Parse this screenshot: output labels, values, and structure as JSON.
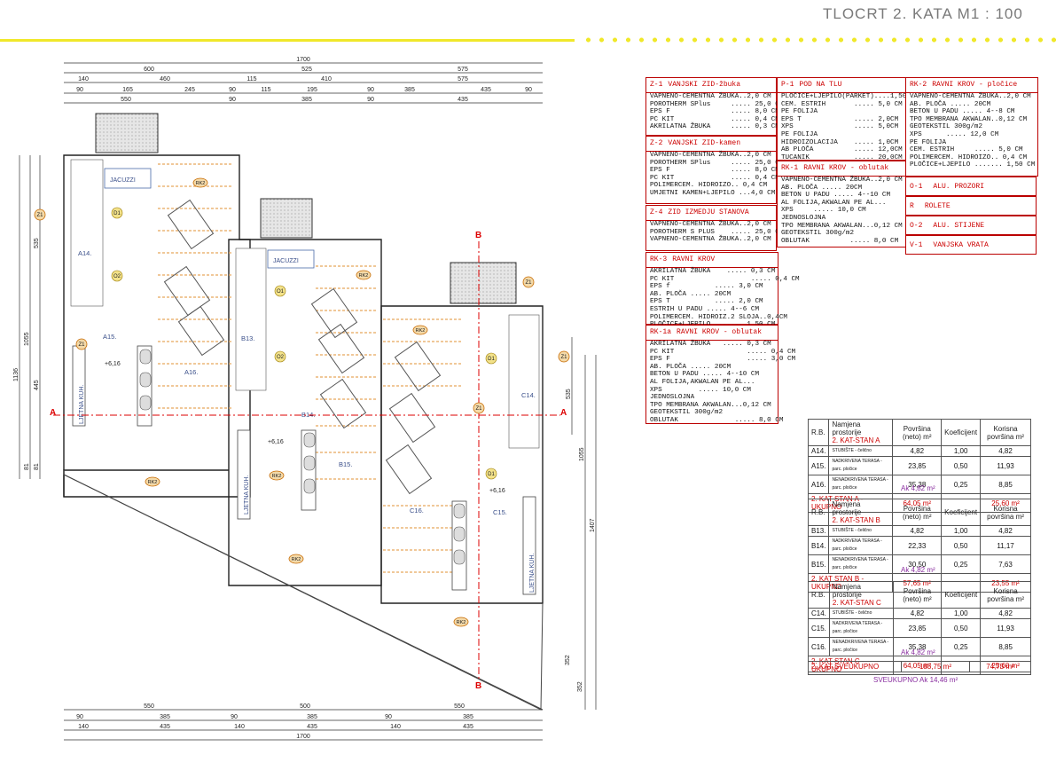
{
  "header": {
    "title": "TLOCRT  2. KATA   M1 : 100",
    "accent": "#f0e82a"
  },
  "plan": {
    "dim_top": {
      "row1": [
        "1700"
      ],
      "row2": [
        "600",
        "525",
        "575"
      ],
      "row3": [
        "140",
        "460",
        "115",
        "410",
        "575"
      ],
      "row4": [
        "90",
        "165",
        "245",
        "90",
        "115",
        "195",
        "90",
        "385",
        "435",
        "90"
      ],
      "row5": [
        "550",
        "90",
        "385",
        "90",
        "435"
      ]
    },
    "dim_bottom": {
      "row1": [
        "550",
        "500",
        "550"
      ],
      "row2": [
        "90",
        "385",
        "90",
        "385",
        "90",
        "385"
      ],
      "row3": [
        "140",
        "435",
        "140",
        "435",
        "140",
        "435"
      ],
      "row4": [
        "1700"
      ]
    },
    "dim_left": [
      "1136",
      "1055",
      "535",
      "445",
      "81",
      "81"
    ],
    "dim_right": [
      "535",
      "1055",
      "1407",
      "352",
      "352"
    ],
    "rooms": [
      "A14.",
      "A15.",
      "A16.",
      "B13.",
      "B14.",
      "B15.",
      "C14.",
      "C15.",
      "C16."
    ],
    "jacuzzi": "JACUZZI",
    "kitchen": "LJETNA KUH.",
    "levels": [
      "+6,16",
      "+6,16",
      "+6,16"
    ],
    "section_marks": [
      "A",
      "A",
      "B",
      "B"
    ],
    "axes": [
      "Z1",
      "Z1",
      "Z1",
      "Z1",
      "Z1"
    ],
    "tags": {
      "door": "D1",
      "window": "O1",
      "window2": "O2"
    },
    "roof_tag": "RK2"
  },
  "specs": {
    "z1": {
      "code": "Z-1",
      "name": "VANJSKI ZID-žbuka",
      "lines": [
        "VAPNENO-CEMENTNA ŽBUKA..2,0 CM",
        "POROTHERM SPlus     ..... 25,0 CM",
        "EPS F               ..... 8,0 CM",
        "PC KIT              ..... 0,4 CM",
        "AKRILATNA ŽBUKA     ..... 0,3 CM"
      ]
    },
    "z2": {
      "code": "Z-2",
      "name": "VANJSKI ZID-kamen",
      "lines": [
        "VAPNENO-CEMENTNA ŽBUKA..2,0 CM",
        "POROTHERM SPlus     ..... 25,0 CM",
        "EPS F               ..... 8,0 CM",
        "PC KIT              ..... 0,4 CM",
        "POLIMERCEM. HIDROIZO.. 0,4 CM",
        "UMJETNI KAMEN+LJEPILO ...4,0 CM"
      ]
    },
    "z4": {
      "code": "Z-4",
      "name": "ZID IZMEDJU STANOVA",
      "lines": [
        "VAPNENO-CEMENTNA ŽBUKA..2,0 CM",
        "POROTHERM S PLUS    ..... 25,0 CM",
        "VAPNENO-CEMENTNA ŽBUKA..2,0 CM"
      ]
    },
    "rk3": {
      "code": "RK-3",
      "name": "RAVNI KROV",
      "lines": [
        "AKRILATNA ŽBUKA    ..... 0,3 CM",
        "PC KIT                   ..... 0,4 CM",
        "EPS f           ..... 3,0 CM",
        "AB. PLOČA ..... 20CM",
        "EPS T           ..... 2,0 CM",
        "ESTRIH U PADU ..... 4--6 CM",
        "POLIMERCEM. HIDROIZ.2 SLOJA..0,4CM",
        "PLOČICE+LJEPILO ....... 1,50 CM"
      ]
    },
    "rk1a": {
      "code": "RK-1a",
      "name": "RAVNI KROV - oblutak",
      "lines": [
        "AKRILATNA ŽBUKA   ..... 0,3 CM",
        "PC KIT                  ..... 0,4 CM",
        "EPS F                   ..... 3,0 CM",
        "AB. PLOČA ..... 20CM",
        "BETON U PADU ..... 4--10 CM",
        "AL FOLIJA,AKWALAN PE AL...",
        "XPS         ..... 10,0 CM",
        "JEDNOSLOJNA",
        "TPO MEMBRANA AKWALAN...0,12 CM",
        "GEOTEKSTIL 300g/m2",
        "OBLUTAK              ..... 8,0 CM"
      ]
    },
    "p1": {
      "code": "P-1",
      "name": "POD NA TLU",
      "lines": [
        "PLOČICE+LJEPILO(PARKET)....1,50CM",
        "CEM. ESTRIH       ..... 5,0 CM",
        "PE FOLIJA",
        "EPS T             ..... 2,0CM",
        "XPS               ..... 5,0CM",
        "PE FOLIJA",
        "HIDROIZOLACIJA    ..... 1,0CM",
        "AB PLOČA          ..... 12,0CM",
        "TUCANIK           ..... 20,0CM"
      ]
    },
    "rk1": {
      "code": "RK-1",
      "name": "RAVNI KROV - oblutak",
      "lines": [
        "VAPNENO-CEMENTNA ŽBUKA..2,0 CM",
        "AB. PLOČA ..... 20CM",
        "BETON U PADU ..... 4--10 CM",
        "AL FOLIJA,AKWALAN PE AL...",
        "XPS     ..... 10,0 CM",
        "JEDNOSLOJNA",
        "TPO MEMBRANA AKWALAN...0,12 CM",
        "GEOTEKSTIL 300g/m2",
        "OBLUTAK          ..... 8,0 CM"
      ]
    },
    "rk2": {
      "code": "RK-2",
      "name": "RAVNI KROV - pločice",
      "lines": [
        "VAPNENO-CEMENTNA ŽBUKA..2,0 CM",
        "AB. PLOČA ..... 20CM",
        "BETON U PADU ..... 4--8 CM",
        "TPO MEMBRANA AKWALAN..0,12 CM",
        "GEOTEKSTIL 300g/m2",
        "XPS      ..... 12,0 CM",
        "PE FOLIJA",
        "CEM. ESTRIH     ..... 5,0 CM",
        "POLIMERCEM. HIDROIZO.. 0,4 CM",
        "PLOČICE+LJEPILO ....... 1,50 CM"
      ]
    },
    "legend": [
      {
        "code": "O-1",
        "name": "ALU. PROZORI"
      },
      {
        "code": "R",
        "name": "ROLETE"
      },
      {
        "code": "O-2",
        "name": "ALU. STIJENE"
      },
      {
        "code": "V-1",
        "name": "VANJSKA VRATA"
      }
    ]
  },
  "tables": {
    "head": {
      "rb": "R.B.",
      "namjena": "Namjena prostorije",
      "povrsina": "Površina (neto) m²",
      "koef": "Koeficijent",
      "korisna": "Korisna površina m²"
    },
    "a": {
      "title": "2. KAT-STAN A",
      "rows": [
        {
          "rb": "A14.",
          "name": "STUBIŠTE - čelično",
          "pov": "4,82",
          "koef": "1,00",
          "kor": "4,82"
        },
        {
          "rb": "A15.",
          "name": "NADKRIVENA TERASA - parc. pločice",
          "pov": "23,85",
          "koef": "0,50",
          "kor": "11,93"
        },
        {
          "rb": "A16.",
          "name": "NENADKRIVENA TERASA - parc. pločice",
          "pov": "35,38",
          "koef": "0,25",
          "kor": "8,85"
        }
      ],
      "total_label": "2. KAT STAN A - UKUPNO",
      "total_pov": "64,05 m²",
      "total_kor": "25,60 m²",
      "ak": "Ak 4,82 m²"
    },
    "b": {
      "title": "2. KAT-STAN B",
      "rows": [
        {
          "rb": "B13.",
          "name": "STUBIŠTE - čelično",
          "pov": "4,82",
          "koef": "1,00",
          "kor": "4,82"
        },
        {
          "rb": "B14.",
          "name": "NADKRIVENA TERASA - parc. pločice",
          "pov": "22,33",
          "koef": "0,50",
          "kor": "11,17"
        },
        {
          "rb": "B15.",
          "name": "NENADKRIVENA TERASA - parc. pločice",
          "pov": "30,50",
          "koef": "0,25",
          "kor": "7,63"
        }
      ],
      "total_label": "2. KAT STAN B - UKUPNO",
      "total_pov": "57,65 m²",
      "total_kor": "23,55 m²",
      "ak": "Ak 4,82 m²"
    },
    "c": {
      "title": "2. KAT-STAN C",
      "rows": [
        {
          "rb": "C14.",
          "name": "STUBIŠTE - čelično",
          "pov": "4,82",
          "koef": "1,00",
          "kor": "4,82"
        },
        {
          "rb": "C15.",
          "name": "NADKRIVENA TERASA - parc. pločice",
          "pov": "23,85",
          "koef": "0,50",
          "kor": "11,93"
        },
        {
          "rb": "C16.",
          "name": "NENADKRIVENA TERASA - parc. pločice",
          "pov": "35,38",
          "koef": "0,25",
          "kor": "8,85"
        }
      ],
      "total_label": "2. KAT STAN C - UKUPNO",
      "total_pov": "64,05 m²",
      "total_kor": "25,60 m²",
      "ak": "Ak 4,82 m²"
    },
    "grand": {
      "label": "2. KAT SVEUKUPNO",
      "pov": "185,75 m²",
      "kor": "74,75 m²",
      "ak": "SVEUKUPNO  Ak 14,46 m²"
    }
  }
}
